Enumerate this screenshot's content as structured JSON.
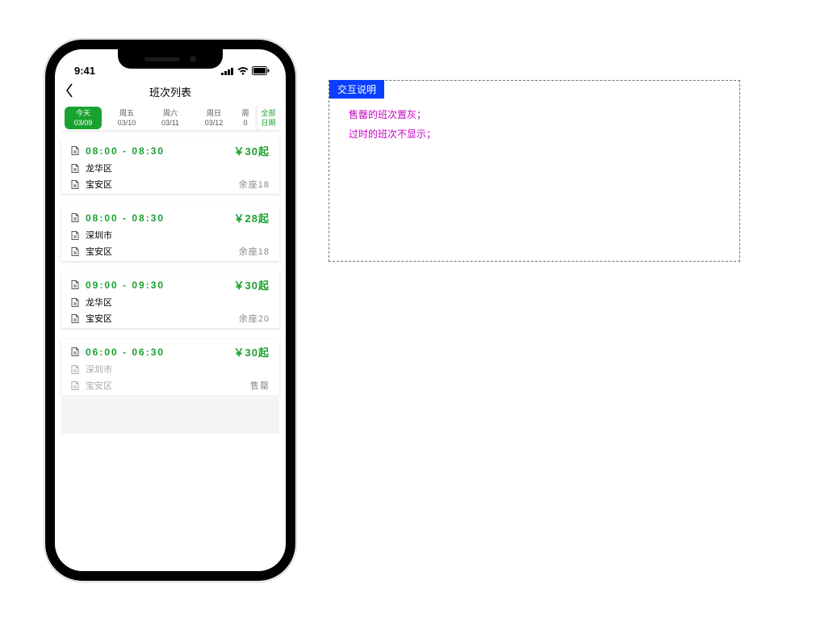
{
  "statusbar": {
    "time": "9:41"
  },
  "nav": {
    "title": "班次列表"
  },
  "datebar": {
    "chips": [
      {
        "line1": "今天",
        "line2": "03/09",
        "active": true
      },
      {
        "line1": "周五",
        "line2": "03/10",
        "active": false
      },
      {
        "line1": "周六",
        "line2": "03/11",
        "active": false
      },
      {
        "line1": "周日",
        "line2": "03/12",
        "active": false
      },
      {
        "line1": "周",
        "line2": "0",
        "active": false
      }
    ],
    "all": {
      "line1": "全部",
      "line2": "日期"
    }
  },
  "cards": [
    {
      "time": "08:00 - 08:30",
      "price": "￥30起",
      "loc1": "龙华区",
      "loc2": "宝安区",
      "seats": "余座18",
      "soldout": false
    },
    {
      "time": "08:00 - 08:30",
      "price": "￥28起",
      "loc1": "深圳市",
      "loc2": "宝安区",
      "seats": "余座18",
      "soldout": false
    },
    {
      "time": "09:00 - 09:30",
      "price": "￥30起",
      "loc1": "龙华区",
      "loc2": "宝安区",
      "seats": "余座20",
      "soldout": false
    },
    {
      "time": "06:00 - 06:30",
      "price": "￥30起",
      "loc1": "深圳市",
      "loc2": "宝安区",
      "seats": "售罄",
      "soldout": true
    }
  ],
  "colors": {
    "accent": "#19a22f"
  },
  "annotation": {
    "header": "交互说明",
    "line1": "售罄的班次置灰；",
    "line2": "过时的班次不显示；"
  }
}
